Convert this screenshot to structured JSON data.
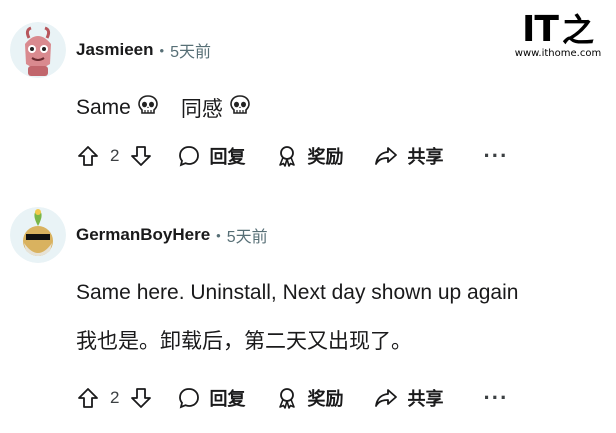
{
  "watermark": {
    "logo_text": "IT之家",
    "brand": "IT",
    "char": "之",
    "url": "www.ithome.com"
  },
  "comments": [
    {
      "author": "Jasmieen",
      "separator": "•",
      "time": "5天前",
      "text": "Same",
      "text_secondary": "同感",
      "emoji": "skull-emoji",
      "actions": {
        "votes": "2",
        "reply": "回复",
        "award": "奖励",
        "share": "共享",
        "more": "···"
      }
    },
    {
      "author": "GermanBoyHere",
      "separator": "•",
      "time": "5天前",
      "text": "Same here. Uninstall, Next day shown up again",
      "text_secondary": "我也是。卸载后，第二天又出现了。",
      "actions": {
        "votes": "2",
        "reply": "回复",
        "award": "奖励",
        "share": "共享",
        "more": "···"
      }
    }
  ]
}
